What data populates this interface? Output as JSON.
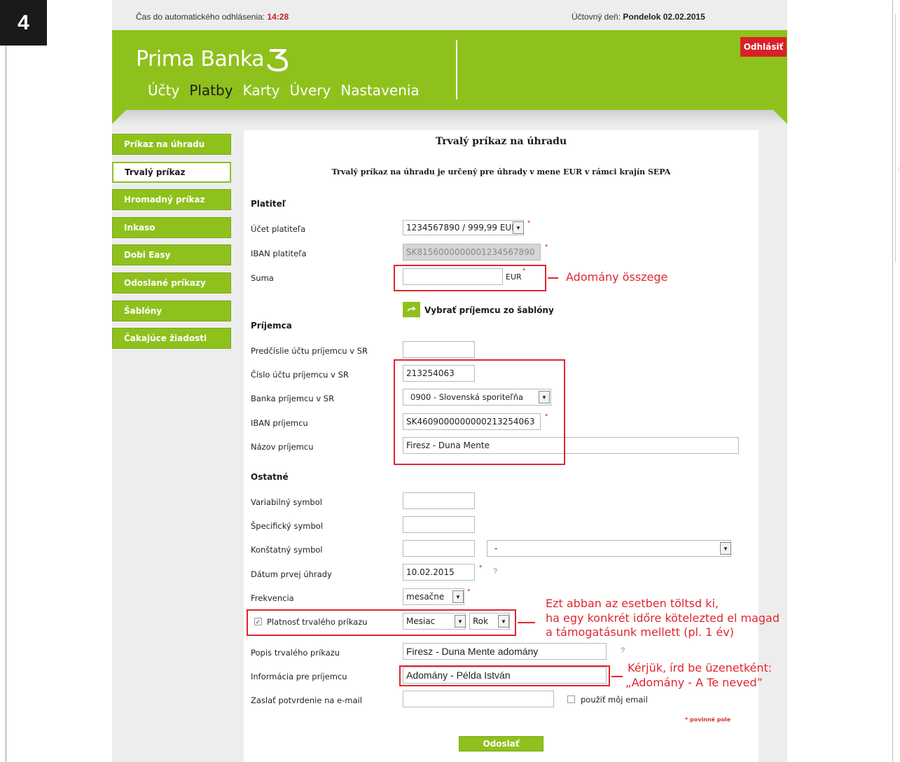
{
  "step_number": "4",
  "topbar": {
    "timer_label": "Čas do automatického odhlásenia: ",
    "timer_value": "14:28",
    "day_label": "Účtovný deň: ",
    "day_value": "Pondelok 02.02.2015"
  },
  "header": {
    "logo_text": "Prima Banka",
    "logout_label": "Odhlásiť",
    "nav": [
      "Účty",
      "Platby",
      "Karty",
      "Úvery",
      "Nastavenia"
    ],
    "nav_active": "Platby"
  },
  "sidebar": {
    "items": [
      {
        "label": "Príkaz na úhradu"
      },
      {
        "label": "Trvalý príkaz"
      },
      {
        "label": "Hromadný príkaz"
      },
      {
        "label": "Inkaso"
      },
      {
        "label": "Dobi Easy"
      },
      {
        "label": "Odoslané príkazy"
      },
      {
        "label": "Šablóny"
      },
      {
        "label": "Čakajúce žiadosti"
      }
    ],
    "active": "Trvalý príkaz"
  },
  "form": {
    "title": "Trvalý príkaz na úhradu",
    "subtitle": "Trvalý príkaz na úhradu je určený pre úhrady v mene EUR v rámci krajín SEPA",
    "payer": {
      "section": "Platiteľ",
      "account_label": "Účet platiteľa",
      "account_value": "1234567890 / 999,99 EUR",
      "iban_label": "IBAN platiteľa",
      "iban_value": "SK8156000000001234567890",
      "amount_label": "Suma",
      "amount_value": "",
      "currency": "EUR"
    },
    "template_button_label": "Vybrať príjemcu zo šablóny",
    "recipient": {
      "section": "Príjemca",
      "prefix_label": "Predčíslie účtu príjemcu v SR",
      "prefix_value": "",
      "account_label": "Číslo účtu príjemcu v SR",
      "account_value": "213254063",
      "bank_label": "Banka príjemcu v SR",
      "bank_value": "0900 - Slovenská sporiteľňa",
      "iban_label": "IBAN príjemcu",
      "iban_value": "SK4609000000000213254063",
      "name_label": "Názov príjemcu",
      "name_value": "Firesz - Duna Mente"
    },
    "other": {
      "section": "Ostatné",
      "variable_label": "Variabilný symbol",
      "variable_value": "",
      "specific_label": "Špecifický symbol",
      "specific_value": "",
      "constant_label": "Konštatný symbol",
      "constant_value": "",
      "constant_select_value": "-",
      "first_date_label": "Dátum prvej úhrady",
      "first_date_value": "10.02.2015",
      "frequency_label": "Frekvencia",
      "frequency_value": "mesačne",
      "validity_label": "Platnosť trvalého príkazu",
      "validity_checked": true,
      "validity_unit_value": "Mesiac",
      "validity_unit2_value": "Rok",
      "description_label": "Popis trvalého príkazu",
      "description_value": "Firesz - Duna Mente adomány",
      "info_label": "Informácia pre príjemcu",
      "info_value": "Adomány - Példa István",
      "email_label": "Zaslať potvrdenie na e-mail",
      "email_value": "",
      "use_my_email_label": "použiť môj email",
      "required_note": "* povinné pole"
    },
    "submit_label": "Odoslať"
  },
  "annotations": {
    "amount_note": "Adomány összege",
    "validity_note_line1": "Ezt abban az esetben töltsd ki,",
    "validity_note_line2": "ha egy konkrét időre kötelezted el magad",
    "validity_note_line3": "a támogatásunk mellett (pl. 1 év)",
    "info_note_line1": "Kérjük, írd be üzenetként:",
    "info_note_line2": "„Adomány - A Te neved”"
  },
  "colors": {
    "brand_green": "#8fc11d",
    "logout_red": "#d92028",
    "annotation_red": "#e0262f"
  },
  "icons": {
    "template_button": "arrow-right-icon",
    "select": "chevron-down-icon"
  }
}
